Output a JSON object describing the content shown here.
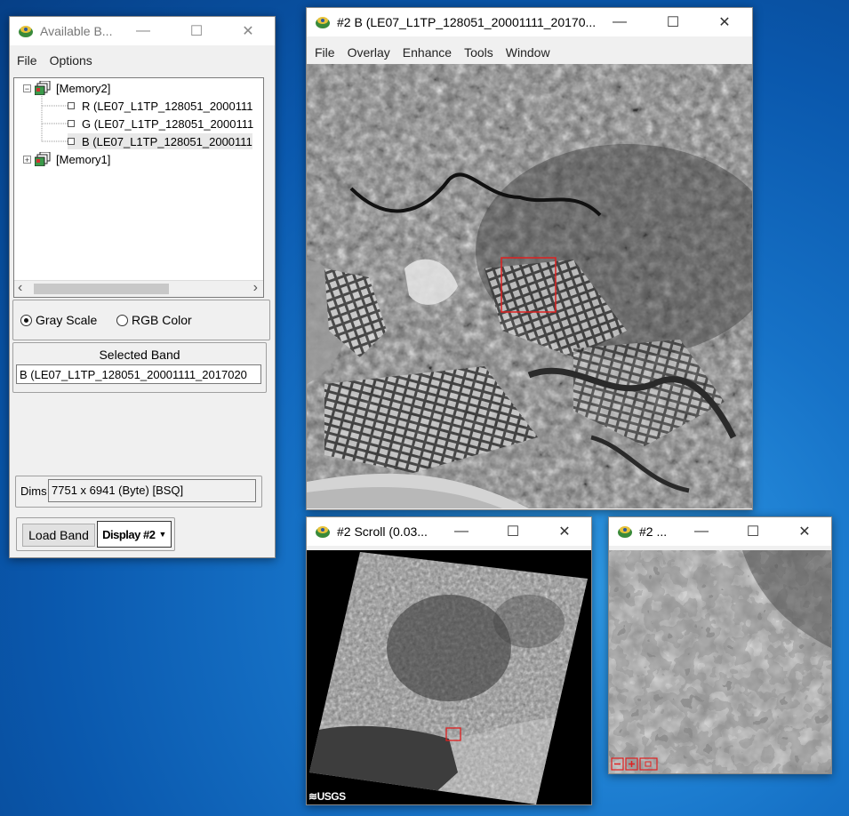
{
  "bands_window": {
    "title": "Available B...",
    "menu": [
      "File",
      "Options"
    ],
    "tree": {
      "memory2_label": "[Memory2]",
      "memory2_bands": [
        "R (LE07_L1TP_128051_2000111",
        "G (LE07_L1TP_128051_2000111",
        "B (LE07_L1TP_128051_2000111"
      ],
      "memory1_label": "[Memory1]",
      "memory2_expander": "−",
      "memory1_expander": "+"
    },
    "scroll_left": "‹",
    "scroll_right": "›",
    "mode": {
      "gray_label": "Gray Scale",
      "rgb_label": "RGB Color",
      "selected": "gray"
    },
    "selected_band_title": "Selected Band",
    "selected_band_value": "B (LE07_L1TP_128051_20001111_2017020",
    "dims_label": "Dims",
    "dims_value": "7751 x 6941 (Byte) [BSQ]",
    "load_band_label": "Load Band",
    "display_label": "Display #2"
  },
  "image_window": {
    "title": "#2 B (LE07_L1TP_128051_20001111_20170...",
    "menu": [
      "File",
      "Overlay",
      "Enhance",
      "Tools",
      "Window"
    ]
  },
  "scroll_window": {
    "title": "#2 Scroll (0.03...",
    "logo_text": "USGS"
  },
  "zoom_window": {
    "title": "#2 ..."
  },
  "controls": {
    "minimize": "—",
    "maximize": "☐",
    "close": "✕"
  },
  "colors": {
    "desktop": "#1672c7",
    "roi_box": "#e02020"
  }
}
